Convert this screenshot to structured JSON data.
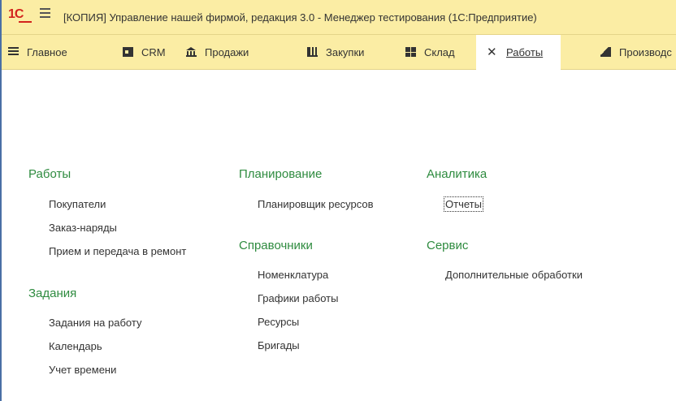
{
  "window": {
    "title": "[КОПИЯ] Управление нашей фирмой, редакция 3.0  - Менеджер тестирования (1С:Предприятие)",
    "logo": "1С"
  },
  "menubar": {
    "items": [
      {
        "label": "Главное",
        "icon": "menu-lines-icon"
      },
      {
        "label": "CRM",
        "icon": "contact-card-icon"
      },
      {
        "label": "Продажи",
        "icon": "bank-icon"
      },
      {
        "label": "Закупки",
        "icon": "cart-icon"
      },
      {
        "label": "Склад",
        "icon": "warehouse-grid-icon"
      },
      {
        "label": "Работы",
        "icon": "tools-icon",
        "active": true
      },
      {
        "label": "Производс",
        "icon": "factory-icon"
      }
    ]
  },
  "sections": {
    "works": {
      "title": "Работы",
      "links": [
        "Покупатели",
        "Заказ-наряды",
        "Прием и передача в ремонт"
      ]
    },
    "tasks": {
      "title": "Задания",
      "links": [
        "Задания на работу",
        "Календарь",
        "Учет времени"
      ]
    },
    "planning": {
      "title": "Планирование",
      "links": [
        "Планировщик ресурсов"
      ]
    },
    "catalogs": {
      "title": "Справочники",
      "links": [
        "Номенклатура",
        "Графики работы",
        "Ресурсы",
        "Бригады"
      ]
    },
    "analytics": {
      "title": "Аналитика",
      "links": [
        "Отчеты"
      ]
    },
    "service": {
      "title": "Сервис",
      "links": [
        "Дополнительные обработки"
      ]
    }
  },
  "colors": {
    "bar_background": "#fbeda4",
    "section_title": "#2e8b3f",
    "logo_red": "#d2231d"
  }
}
